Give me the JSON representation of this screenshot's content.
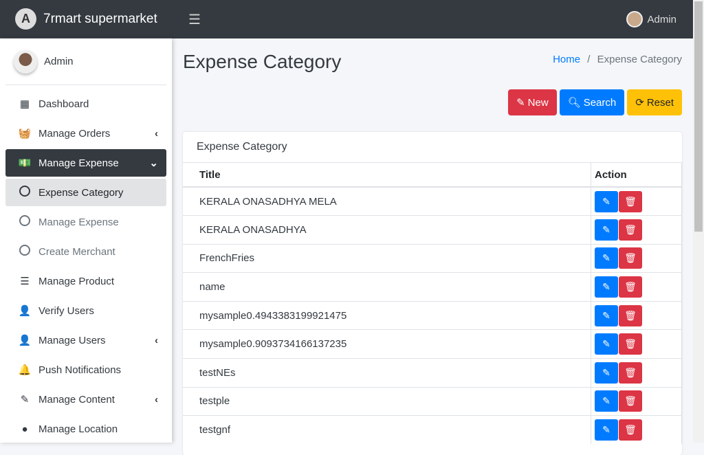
{
  "brand": {
    "name": "7rmart supermarket"
  },
  "topbar": {
    "user": "Admin"
  },
  "sidebar": {
    "user": "Admin",
    "items": [
      {
        "label": "Dashboard",
        "icon": "dashboard-icon",
        "glyph": "▦"
      },
      {
        "label": "Manage Orders",
        "icon": "basket-icon",
        "glyph": "🧺",
        "chevron": "‹"
      },
      {
        "label": "Manage Expense",
        "icon": "money-icon",
        "glyph": "💵",
        "chevron": "⌄"
      },
      {
        "label": "Expense Category",
        "icon": "circle-icon"
      },
      {
        "label": "Manage Expense",
        "icon": "circle-icon"
      },
      {
        "label": "Create Merchant",
        "icon": "circle-icon"
      },
      {
        "label": "Manage Product",
        "icon": "tasks-icon",
        "glyph": "☰"
      },
      {
        "label": "Verify Users",
        "icon": "user-check-icon",
        "glyph": "👤"
      },
      {
        "label": "Manage Users",
        "icon": "user-icon",
        "glyph": "👤",
        "chevron": "‹"
      },
      {
        "label": "Push Notifications",
        "icon": "bell-icon",
        "glyph": "🔔"
      },
      {
        "label": "Manage Content",
        "icon": "edit-icon",
        "glyph": "✎",
        "chevron": "‹"
      },
      {
        "label": "Manage Location",
        "icon": "map-marker-icon",
        "glyph": "●"
      }
    ]
  },
  "page": {
    "title": "Expense Category",
    "breadcrumb": {
      "home": "Home",
      "sep": "/",
      "current": "Expense Category"
    }
  },
  "buttons": {
    "new": "New",
    "search": "Search",
    "reset": "Reset"
  },
  "colors": {
    "new": "#dc3545",
    "search": "#007bff",
    "reset": "#ffc107",
    "dark": "#343a40"
  },
  "card": {
    "title": "Expense Category",
    "columns": [
      "Title",
      "Action"
    ],
    "rows": [
      "KERALA ONASADHYA MELA",
      "KERALA ONASADHYA",
      "FrenchFries",
      "name",
      "mysample0.4943383199921475",
      "mysample0.9093734166137235",
      "testNEs",
      "testple",
      "testgnf"
    ]
  }
}
